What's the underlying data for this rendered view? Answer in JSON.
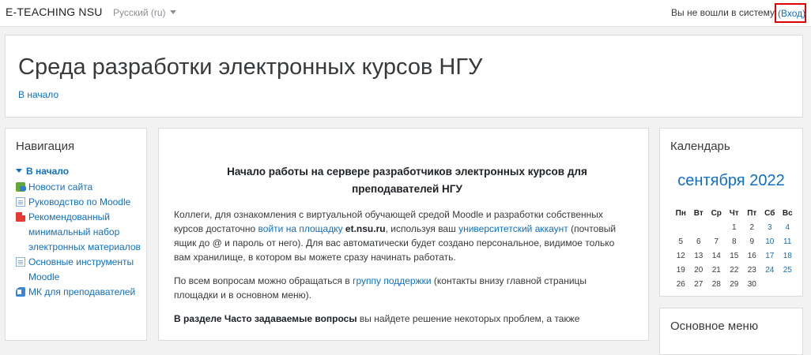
{
  "navbar": {
    "brand": "E-TEACHING NSU",
    "language": "Русский (ru)",
    "login_status": "Вы не вошли в систему",
    "login_link": "(Вход)"
  },
  "header": {
    "title": "Среда разработки электронных курсов НГУ",
    "breadcrumb": "В начало"
  },
  "navigation": {
    "title": "Навигация",
    "root": "В начало",
    "items": [
      {
        "label": "Новости сайта",
        "icon": "forum-icon"
      },
      {
        "label": "Руководство по Moodle",
        "icon": "page-icon"
      },
      {
        "label": "Рекомендованный минимальный набор электронных материалов",
        "icon": "pdf-icon"
      },
      {
        "label": "Основные инструменты Moodle",
        "icon": "page-icon"
      },
      {
        "label": "МК для преподавателей",
        "icon": "book-icon"
      }
    ]
  },
  "main": {
    "heading": "Начало работы на сервере разработчиков электронных курсов для преподавателей НГУ",
    "p1_a": "Коллеги, для ознакомления с виртуальной обучающей средой Moodle и разработки собственных курсов достаточно ",
    "p1_link1": "войти на площадку",
    "p1_site": "et.nsu.ru",
    "p1_b": ", используя ваш ",
    "p1_link2": "университетский аккаунт",
    "p1_c": " (почтовый ящик до @ и пароль от него). Для вас автоматически будет создано персональное, видимое только вам хранилище, в котором вы можете сразу начинать работать.",
    "p2_a": "По всем вопросам можно обращаться в ",
    "p2_link": "группу поддержки",
    "p2_b": " (контакты внизу главной страницы площадки и в основном меню).",
    "p3_bold": "В разделе ",
    "p3_link": "Часто задаваемые вопросы",
    "p3_rest": " вы найдете решение некоторых проблем, а также"
  },
  "calendar": {
    "title": "Календарь",
    "month": "сентября 2022",
    "weekdays": [
      "Пн",
      "Вт",
      "Ср",
      "Чт",
      "Пт",
      "Сб",
      "Вс"
    ],
    "weeks": [
      [
        "",
        "",
        "",
        "1",
        "2",
        "3",
        "4"
      ],
      [
        "5",
        "6",
        "7",
        "8",
        "9",
        "10",
        "11"
      ],
      [
        "12",
        "13",
        "14",
        "15",
        "16",
        "17",
        "18"
      ],
      [
        "19",
        "20",
        "21",
        "22",
        "23",
        "24",
        "25"
      ],
      [
        "26",
        "27",
        "28",
        "29",
        "30",
        "",
        ""
      ]
    ]
  },
  "main_menu": {
    "title": "Основное меню"
  },
  "colors": {
    "link": "#0f6fc5",
    "highlight": "#e00000",
    "background": "#f2f2f2"
  }
}
